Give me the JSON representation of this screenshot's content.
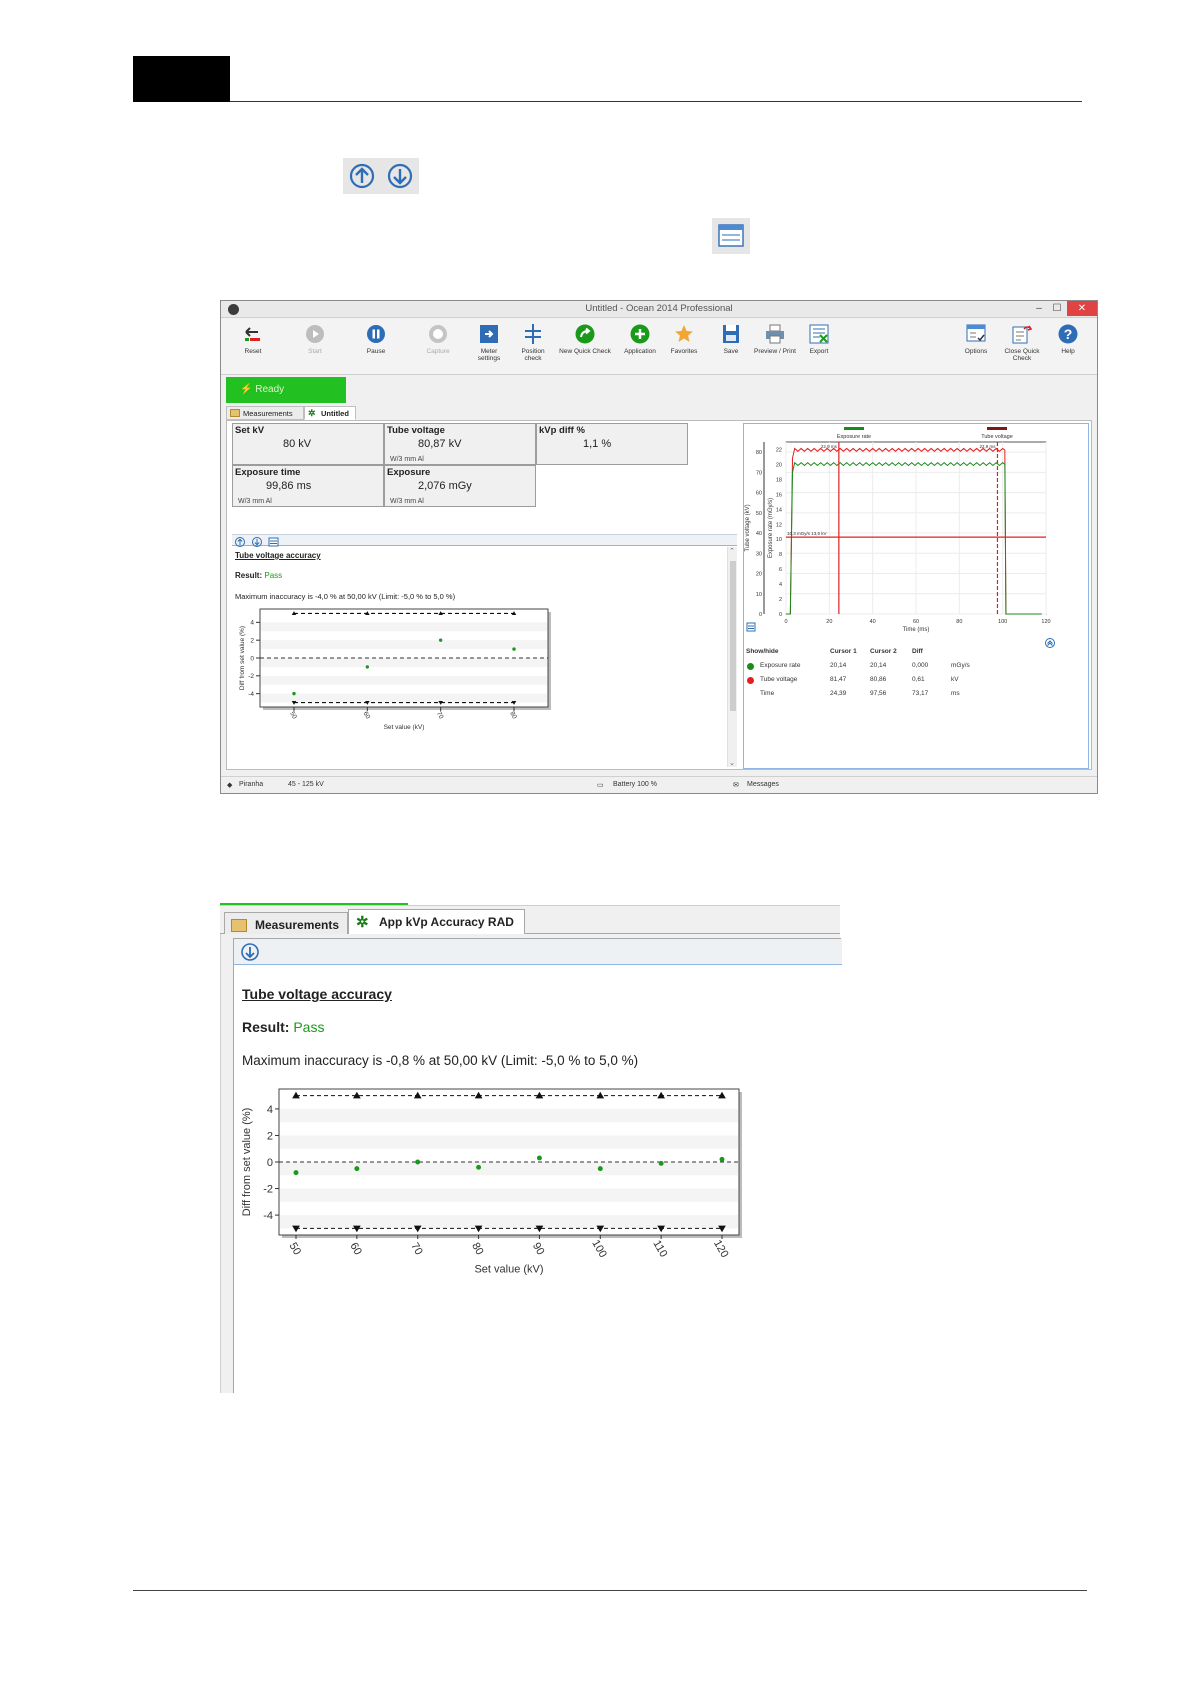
{
  "window": {
    "title": "Untitled - Ocean 2014 Professional",
    "controls": [
      "–",
      "☐",
      "✕"
    ]
  },
  "ribbon": [
    {
      "label": "Reset",
      "icon": "reset-icon",
      "enabled": true
    },
    {
      "label": "Start",
      "icon": "play-icon",
      "enabled": false
    },
    {
      "label": "Pause",
      "icon": "pause-icon",
      "enabled": true
    },
    {
      "label": "Capture",
      "icon": "capture-icon",
      "enabled": false
    },
    {
      "label": "Meter settings",
      "icon": "meter-settings-icon",
      "enabled": true
    },
    {
      "label": "Position check",
      "icon": "position-check-icon",
      "enabled": true
    },
    {
      "label": "New Quick Check",
      "icon": "new-quick-check-icon",
      "enabled": true
    },
    {
      "label": "Application",
      "icon": "add-application-icon",
      "enabled": true
    },
    {
      "label": "Favorites",
      "icon": "star-icon",
      "enabled": true
    },
    {
      "label": "Save",
      "icon": "save-icon",
      "enabled": true
    },
    {
      "label": "Preview / Print",
      "icon": "printer-icon",
      "enabled": true
    },
    {
      "label": "Export",
      "icon": "export-icon",
      "enabled": true
    },
    {
      "label": "Options",
      "icon": "options-icon",
      "enabled": true
    },
    {
      "label": "Close Quick Check",
      "icon": "close-quick-check-icon",
      "enabled": true
    },
    {
      "label": "Help",
      "icon": "help-icon",
      "enabled": true
    }
  ],
  "status": {
    "text": "Ready"
  },
  "tabs1": [
    "Measurements",
    "Untitled"
  ],
  "measurements": {
    "set_kv": {
      "label": "Set kV",
      "value": "80  kV"
    },
    "tube_voltage": {
      "label": "Tube voltage",
      "value": "80,87  kV",
      "sub": "W/3 mm Al"
    },
    "kvp_diff": {
      "label": "kVp diff %",
      "value": "1,1  %"
    },
    "exposure_time": {
      "label": "Exposure time",
      "value": "99,86  ms",
      "sub": "W/3 mm Al"
    },
    "exposure": {
      "label": "Exposure",
      "value": "2,076  mGy",
      "sub": "W/3 mm Al"
    }
  },
  "report1": {
    "title": "Tube voltage accuracy",
    "result_label": "Result:",
    "result_value": "Pass",
    "max_text": "Maximum inaccuracy is -4,0 % at 50,00 kV (Limit: -5,0 % to 5,0 %)"
  },
  "waveform": {
    "legend": [
      "Exposure rate",
      "Tube voltage"
    ],
    "xlabel": "Time (ms)",
    "ylabel_left": "Tube voltage (kV)",
    "ylabel_right": "Exposure rate (mGy/s)",
    "x_ticks": [
      "0",
      "20",
      "40",
      "60",
      "80",
      "100",
      "120"
    ],
    "kv_ticks": [
      "0",
      "10",
      "20",
      "30",
      "40",
      "50",
      "60",
      "70",
      "80"
    ],
    "rate_ticks": [
      "0",
      "2",
      "4",
      "6",
      "8",
      "10",
      "12",
      "14",
      "16",
      "18",
      "20",
      "22"
    ],
    "cursor1_tag": "22,9 ms",
    "cursor2_tag": "22,9 ms",
    "level_tag": "10,3 mGy/s  13,5 kV",
    "colors": {
      "exposure_rate": "#1a8a1a",
      "tube_voltage": "#e02020"
    }
  },
  "cursor_table": {
    "headers": [
      "Show/hide",
      "Cursor 1",
      "Cursor 2",
      "Diff",
      ""
    ],
    "rows": [
      {
        "name": "Exposure rate",
        "c1": "20,14",
        "c2": "20,14",
        "diff": "0,000",
        "unit": "mGy/s",
        "color": "#1a8a1a"
      },
      {
        "name": "Tube voltage",
        "c1": "81,47",
        "c2": "80,86",
        "diff": "0,61",
        "unit": "kV",
        "color": "#e02020"
      },
      {
        "name": "Time",
        "c1": "24,39",
        "c2": "97,56",
        "diff": "73,17",
        "unit": "ms",
        "color": ""
      }
    ]
  },
  "statusbar": {
    "device": "Piranha",
    "range": "45 - 125 kV",
    "battery": "Battery 100 %",
    "messages": "Messages"
  },
  "tabs2": [
    "Measurements",
    "App kVp Accuracy RAD"
  ],
  "report2": {
    "title": "Tube voltage accuracy",
    "result_label": "Result:",
    "result_value": "Pass",
    "max_text": "Maximum inaccuracy is -0,8 % at 50,00 kV (Limit: -5,0 % to 5,0 %)"
  },
  "chart_data": [
    {
      "type": "scatter",
      "title": "",
      "xlabel": "Set value (kV)",
      "ylabel": "Diff from set value (%)",
      "x": [
        50,
        60,
        70,
        80
      ],
      "values": [
        -4.0,
        -1.0,
        2.0,
        1.0
      ],
      "limits": [
        -5.0,
        5.0
      ],
      "ylim": [
        -5,
        5
      ],
      "y_ticks": [
        -4,
        -2,
        0,
        2,
        4
      ],
      "x_tick_labels": [
        "50",
        "60",
        "70",
        "80"
      ],
      "colors": {
        "points": "#1a9a1a"
      }
    },
    {
      "type": "scatter",
      "title": "",
      "xlabel": "Set value (kV)",
      "ylabel": "Diff from set value (%)",
      "x": [
        50,
        60,
        70,
        80,
        90,
        100,
        110,
        120
      ],
      "values": [
        -0.8,
        -0.5,
        0.0,
        -0.4,
        0.3,
        -0.5,
        -0.1,
        0.2
      ],
      "limits": [
        -5.0,
        5.0
      ],
      "ylim": [
        -5,
        5
      ],
      "y_ticks": [
        -4,
        -2,
        0,
        2,
        4
      ],
      "x_tick_labels": [
        "50",
        "60",
        "70",
        "80",
        "90",
        "100",
        "110",
        "120"
      ],
      "colors": {
        "points": "#1a9a1a"
      }
    }
  ]
}
